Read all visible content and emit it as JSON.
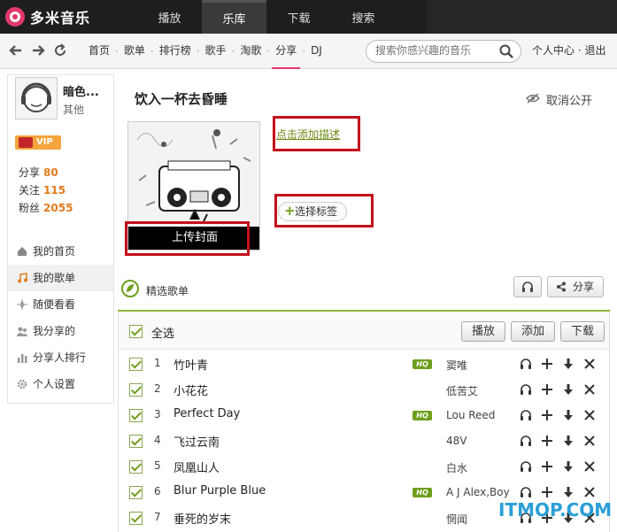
{
  "app": {
    "name": "多米音乐"
  },
  "topnav": [
    "播放",
    "乐库",
    "下载",
    "搜索"
  ],
  "navlinks": [
    "首页",
    "歌单",
    "排行榜",
    "歌手",
    "淘歌",
    "分享",
    "DJ"
  ],
  "search": {
    "placeholder": "搜索你感兴趣的音乐"
  },
  "userlinks": "个人中心 · 退出",
  "user": {
    "name": "暗色...",
    "sub": "其他",
    "vip": "VIP"
  },
  "stats": [
    {
      "label": "分享",
      "value": "80"
    },
    {
      "label": "关注",
      "value": "115"
    },
    {
      "label": "粉丝",
      "value": "2055"
    }
  ],
  "sidemenu": [
    "我的首页",
    "我的歌单",
    "随便看看",
    "我分享的",
    "分享人排行",
    "个人设置"
  ],
  "playlist": {
    "title": "饮入一杯去昏睡",
    "privacy": "取消公开",
    "add_desc": "点击添加描述",
    "select_tag": "选择标签",
    "upload_cover": "上传封面",
    "featured": "精选歌单",
    "share": "分享",
    "select_all": "全选",
    "play": "播放",
    "add": "添加",
    "download": "下载"
  },
  "songs": [
    {
      "num": "1",
      "title": "竹叶青",
      "hq": true,
      "artist": "窦唯"
    },
    {
      "num": "2",
      "title": "小花花",
      "hq": false,
      "artist": "低苦艾"
    },
    {
      "num": "3",
      "title": "Perfect Day",
      "hq": true,
      "artist": "Lou Reed"
    },
    {
      "num": "4",
      "title": "飞过云南",
      "hq": false,
      "artist": "48V"
    },
    {
      "num": "5",
      "title": "凤凰山人",
      "hq": false,
      "artist": "白水"
    },
    {
      "num": "6",
      "title": "Blur Purple Blue",
      "hq": true,
      "artist": "A J Alex,Boy"
    },
    {
      "num": "7",
      "title": "垂死的岁末",
      "hq": false,
      "artist": "惘闻"
    }
  ],
  "hq_label": "HQ",
  "watermark": "ITMOP.COM"
}
